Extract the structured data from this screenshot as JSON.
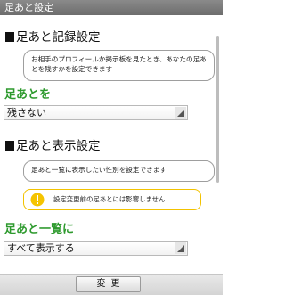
{
  "titlebar": {
    "title": "足あと設定"
  },
  "section_record": {
    "title": "足あと記録設定",
    "note": "お相手のプロフィールか掲示板を見たとき、あなたの足あとを残すかを設定できます",
    "field_label": "足あとを",
    "select_value": "残さない"
  },
  "section_display": {
    "title": "足あと表示設定",
    "note": "足あと一覧に表示したい性別を設定できます",
    "warning": "設定変更前の足あとには影響しません",
    "field_label": "足あと一覧に",
    "select_value": "すべて表示する"
  },
  "footer": {
    "change_button": "変更"
  },
  "colors": {
    "label_green": "#2e9a2e",
    "warning_yellow": "#f2c200",
    "titlebar_gray": "#7a7a7a"
  },
  "icons": {
    "select_arrow": "triangle-down-right-icon",
    "warning": "exclamation-circle-icon"
  }
}
